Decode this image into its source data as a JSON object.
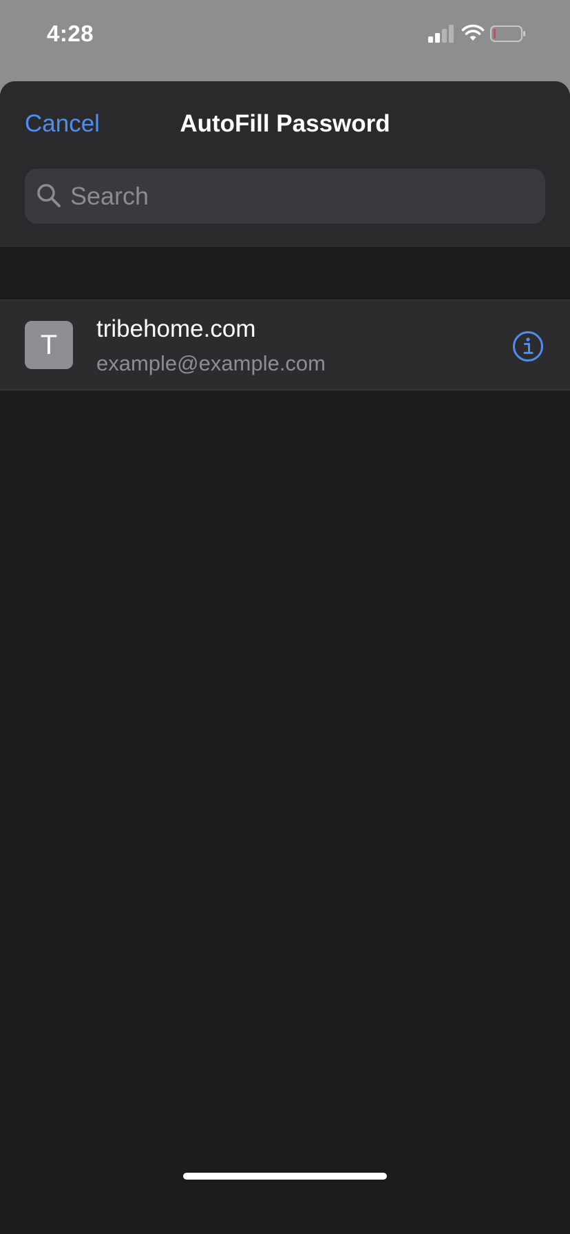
{
  "status_bar": {
    "time": "4:28"
  },
  "nav": {
    "cancel_label": "Cancel",
    "title": "AutoFill Password"
  },
  "search": {
    "placeholder": "Search",
    "value": ""
  },
  "credentials": [
    {
      "avatar_letter": "T",
      "site": "tribehome.com",
      "username": "example@example.com"
    }
  ],
  "colors": {
    "accent": "#4f8ef0",
    "sheet_background": "#1c1c1e",
    "status_background": "#8e8e8e",
    "battery_low": "#e0463e"
  },
  "icons": {
    "signal": "cellular-signal-icon",
    "wifi": "wifi-icon",
    "battery": "battery-icon",
    "search": "magnifying-glass-icon",
    "info": "info-circle-icon"
  }
}
